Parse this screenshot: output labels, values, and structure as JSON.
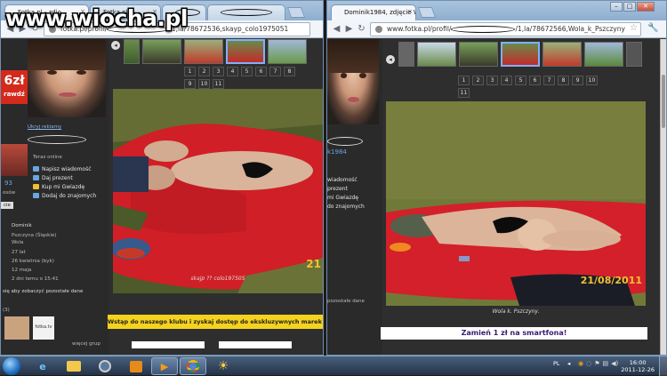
{
  "watermark": "www.wiocha.pl",
  "left": {
    "tabs": [
      {
        "label": "Fotka.pl - zdję"
      },
      {
        "label": "Fotka.pl"
      }
    ],
    "url": "fotka.pl/profil/",
    "url_tail": "/1,la/78672536,skayp_colo1975051",
    "promo_price": "6zł",
    "promo_text": "rawdź",
    "hide_ads": "Ukryj reklamy",
    "online": "Teraz online",
    "menu": [
      "Napisz wiadomość",
      "Daj prezent",
      "Kup mi Gwiazdę",
      "Dodaj do znajomych"
    ],
    "side_count": "93",
    "side_word": "osów",
    "side_btn": "cie",
    "profile": {
      "name": "Dominik",
      "region": "Pszczyna (Śląskie)",
      "city": "Wola",
      "age": "27 lat",
      "birth": "26 kwietnia (byk)",
      "height": "12 maja",
      "last": "2 dni temu o 15:41"
    },
    "see_more": "się aby zobaczyć pozostałe dane",
    "more_count": "(3)",
    "fotka_tv": "fotka.tv",
    "more_link": "więcej grup",
    "pages": [
      "1",
      "2",
      "3",
      "4",
      "5",
      "6",
      "7",
      "8",
      "9",
      "10",
      "11"
    ],
    "caption": "skajp ?? colo197505",
    "banner": "Wstąp do naszego klubu i zyskaj dostęp do ekskluzywnych marek o",
    "photo_date": "21"
  },
  "right": {
    "tab": "Dominik1984, zdjęcie Wola",
    "url_prefix": "www.fotka.pl/profil/",
    "url_tail": "/1,la/78672566,Wola_k_Pszczyny",
    "username": "k1984",
    "menu": [
      "wiadomość",
      "prezent",
      "mi Gwiazdę",
      "do znajomych"
    ],
    "side_more": "pozostałe dane",
    "pages": [
      "1",
      "2",
      "3",
      "4",
      "5",
      "6",
      "7",
      "8",
      "9",
      "10",
      "11"
    ],
    "caption": "Wola k. Pszczyny.",
    "banner": "Zamień 1 zł na smartfona!",
    "photo_date": "21/08/2011"
  },
  "taskbar": {
    "lang": "PL",
    "time": "16:00",
    "date": "2011-12-26"
  },
  "colors": {
    "blanket": "#d3202a",
    "grass": "#6f7a3a",
    "banner_yellow": "#f5d21e",
    "banner_purple": "#3a1a73"
  }
}
